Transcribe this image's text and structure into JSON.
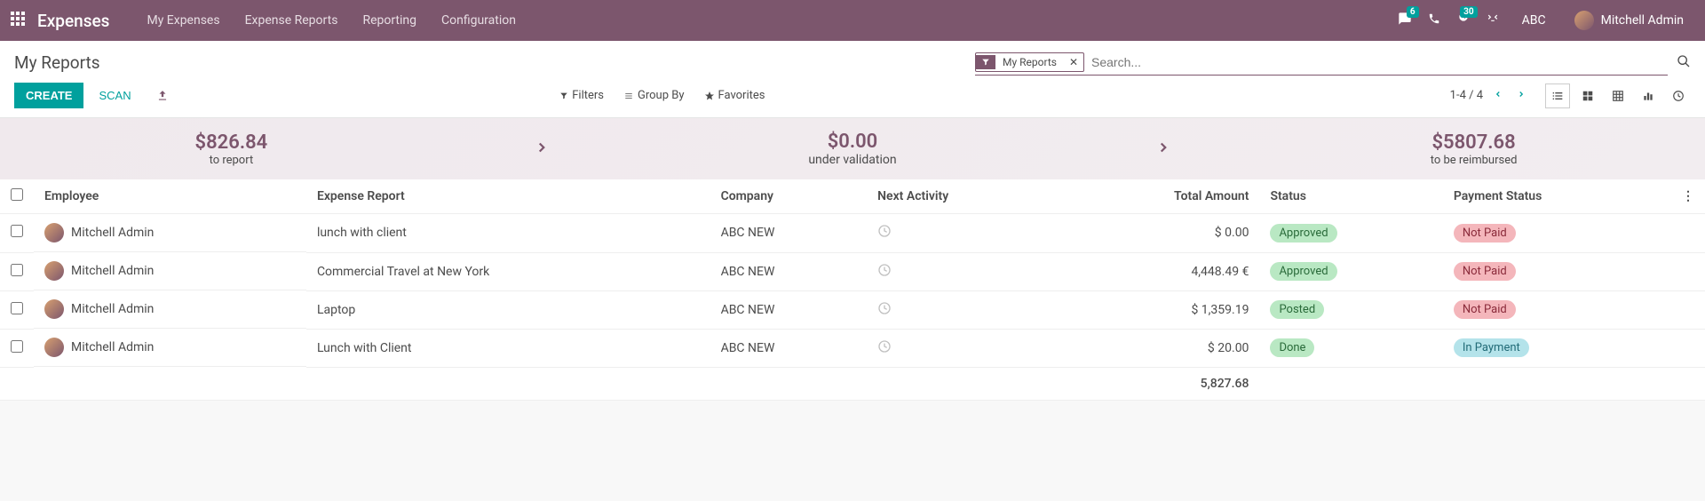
{
  "colors": {
    "brand": "#7c566d",
    "accent": "#00a09d"
  },
  "nav": {
    "app_name": "Expenses",
    "items": [
      "My Expenses",
      "Expense Reports",
      "Reporting",
      "Configuration"
    ],
    "chat_badge": "6",
    "activity_badge": "30",
    "company": "ABC",
    "user_name": "Mitchell Admin"
  },
  "page": {
    "title": "My Reports",
    "create": "CREATE",
    "scan": "SCAN",
    "filters": "Filters",
    "groupby": "Group By",
    "favorites": "Favorites",
    "pager": "1-4 / 4",
    "search_chip": "My Reports",
    "search_placeholder": "Search..."
  },
  "status": {
    "to_report_amount": "$826.84",
    "to_report_label": "to report",
    "under_validation_amount": "$0.00",
    "under_validation_label": "under validation",
    "to_reimburse_amount": "$5807.68",
    "to_reimburse_label": "to be reimbursed"
  },
  "columns": {
    "employee": "Employee",
    "report": "Expense Report",
    "company": "Company",
    "next_activity": "Next Activity",
    "total": "Total Amount",
    "status": "Status",
    "payment": "Payment Status"
  },
  "rows": [
    {
      "employee": "Mitchell Admin",
      "report": "lunch with client",
      "company": "ABC NEW",
      "total": "$ 0.00",
      "status": "Approved",
      "status_class": "b-approved",
      "payment": "Not Paid",
      "payment_class": "b-notpaid"
    },
    {
      "employee": "Mitchell Admin",
      "report": "Commercial Travel at New York",
      "company": "ABC NEW",
      "total": "4,448.49 €",
      "status": "Approved",
      "status_class": "b-approved",
      "payment": "Not Paid",
      "payment_class": "b-notpaid"
    },
    {
      "employee": "Mitchell Admin",
      "report": "Laptop",
      "company": "ABC NEW",
      "total": "$ 1,359.19",
      "status": "Posted",
      "status_class": "b-posted",
      "payment": "Not Paid",
      "payment_class": "b-notpaid"
    },
    {
      "employee": "Mitchell Admin",
      "report": "Lunch with Client",
      "company": "ABC NEW",
      "total": "$ 20.00",
      "status": "Done",
      "status_class": "b-done",
      "payment": "In Payment",
      "payment_class": "b-inpayment"
    }
  ],
  "footer_total": "5,827.68"
}
